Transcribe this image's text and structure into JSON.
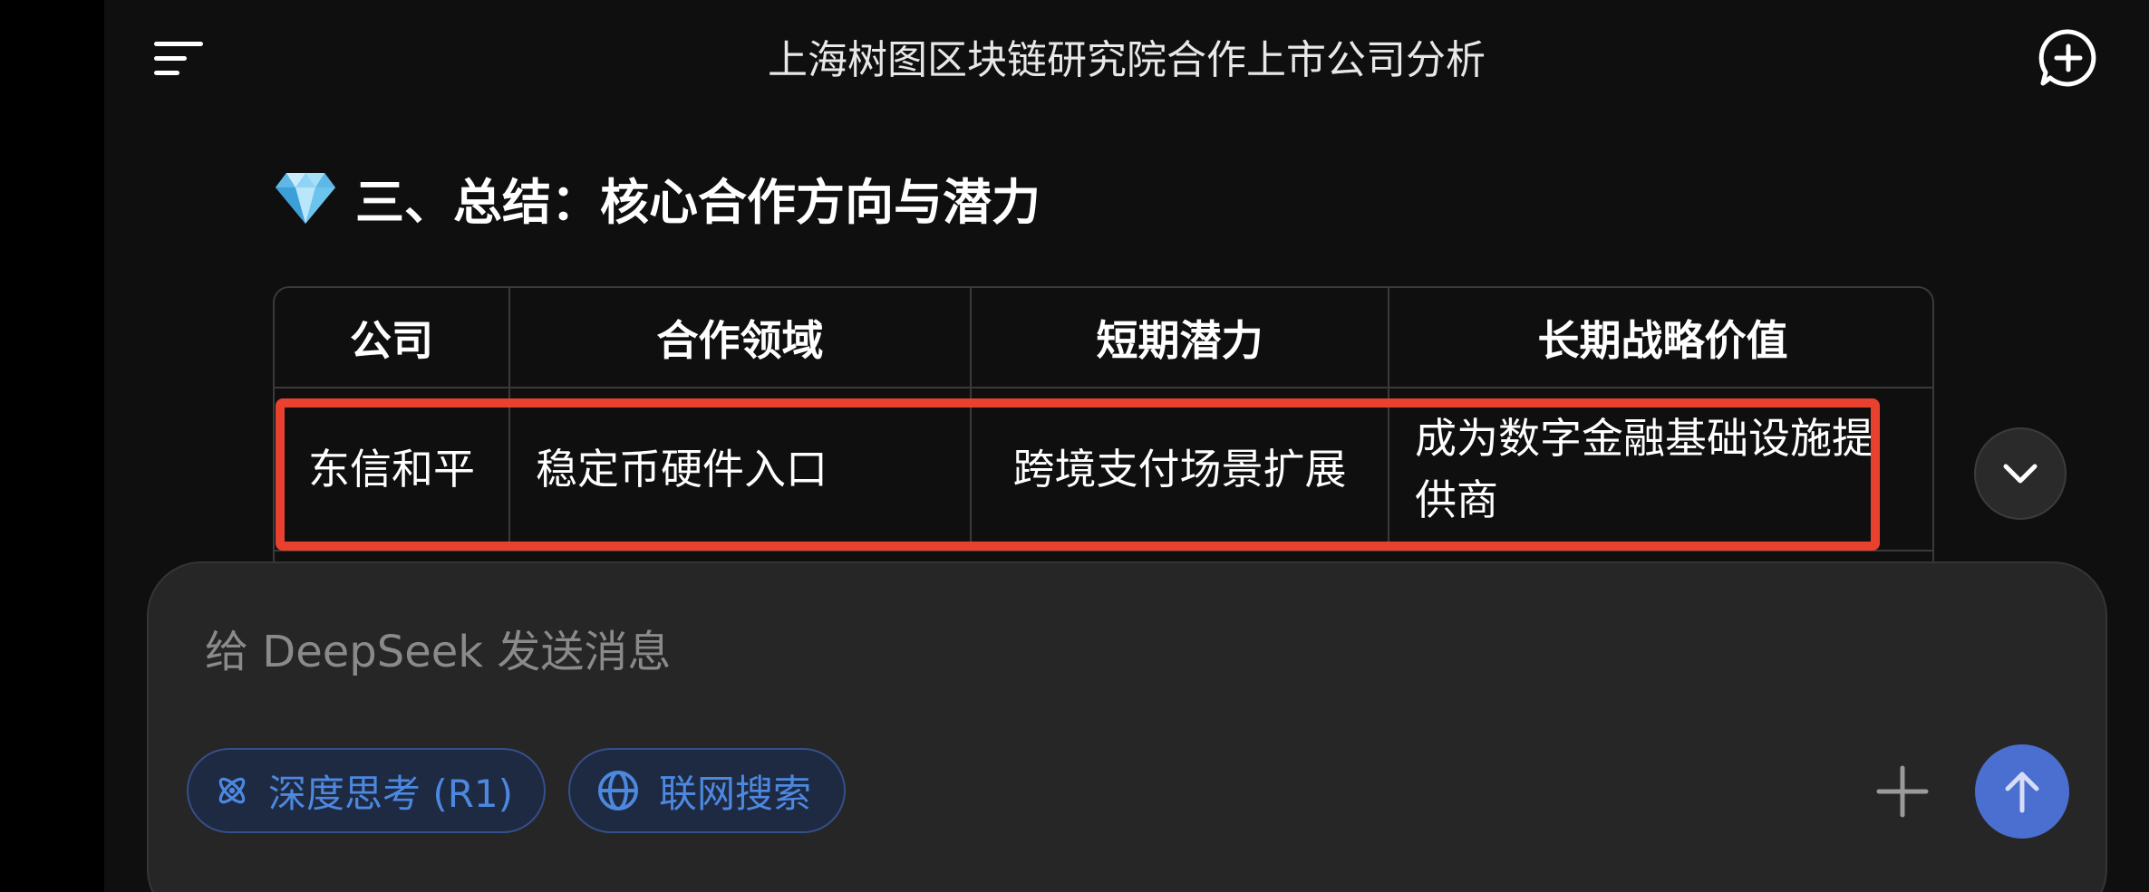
{
  "header": {
    "title": "上海树图区块链研究院合作上市公司分析",
    "menu_icon": "menu-icon",
    "new_chat_icon": "new-chat-icon"
  },
  "section": {
    "icon": "gem-icon",
    "title": "三、总结：核心合作方向与潜力"
  },
  "table": {
    "headers": [
      "公司",
      "合作领域",
      "短期潜力",
      "长期战略价值"
    ],
    "rows": [
      [
        "东信和平",
        "稳定币硬件入口",
        "跨境支付场景扩展",
        "成为数字金融基础设施提供商"
      ]
    ]
  },
  "annotation": {
    "highlight_color": "#e8412f"
  },
  "composer": {
    "placeholder": "给 DeepSeek 发送消息",
    "chips": [
      {
        "label": "深度思考 (R1)",
        "icon": "atom-icon"
      },
      {
        "label": "联网搜索",
        "icon": "globe-icon"
      }
    ],
    "plus_icon": "plus-icon",
    "send_icon": "send-arrow-icon"
  },
  "colors": {
    "background": "#0f0f0f",
    "accent": "#4a6fd1",
    "chip_text": "#4d88e0"
  }
}
